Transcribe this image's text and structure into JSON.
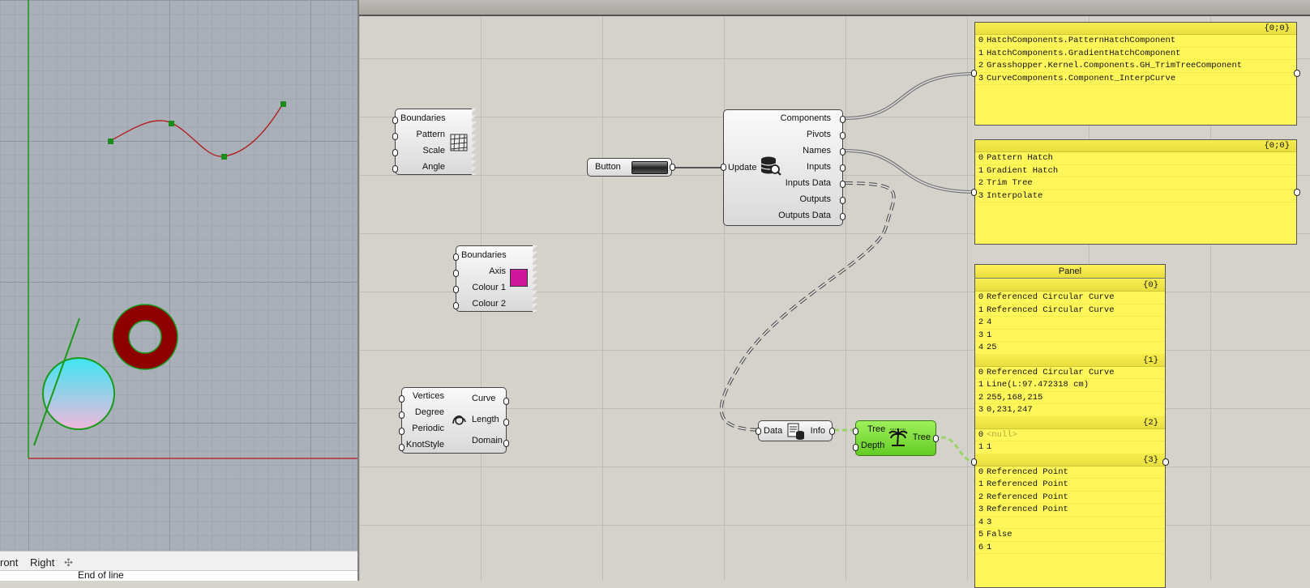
{
  "viewport": {
    "tabs": [
      "ront",
      "Right"
    ],
    "add_tab_icon": "plus-icon",
    "command_prompt": "End of line"
  },
  "components": {
    "hatch_pattern": {
      "inputs": [
        "Boundaries",
        "Pattern",
        "Scale",
        "Angle"
      ],
      "icon": "grid-hatch-icon"
    },
    "hatch_gradient": {
      "inputs": [
        "Boundaries",
        "Axis",
        "Colour 1",
        "Colour 2"
      ],
      "icon": "magenta-swatch-icon"
    },
    "interp_curve": {
      "inputs": [
        "Vertices",
        "Degree",
        "Periodic",
        "KnotStyle"
      ],
      "outputs": [
        "Curve",
        "Length",
        "Domain"
      ],
      "icon": "curve-loop-icon"
    },
    "button": {
      "label": "Button"
    },
    "component_info": {
      "input": "Update",
      "outputs": [
        "Components",
        "Pivots",
        "Names",
        "Inputs",
        "Inputs Data",
        "Outputs",
        "Outputs Data"
      ],
      "icon": "database-search-icon"
    },
    "data_info": {
      "input": "Data",
      "output": "Info",
      "icon": "data-doc-icon"
    },
    "tree": {
      "inputs": [
        "Tree",
        "Depth"
      ],
      "output": "Tree",
      "icon": "palm-tree-icon"
    }
  },
  "panels": {
    "components_panel": {
      "path": "{0;0}",
      "rows": [
        "HatchComponents.PatternHatchComponent",
        "HatchComponents.GradientHatchComponent",
        "Grasshopper.Kernel.Components.GH_TrimTreeComponent",
        "CurveComponents.Component_InterpCurve"
      ]
    },
    "names_panel": {
      "path": "{0;0}",
      "rows": [
        "Pattern Hatch",
        "Gradient Hatch",
        "Trim Tree",
        "Interpolate"
      ]
    },
    "tree_panel": {
      "title": "Panel",
      "branches": [
        {
          "path": "{0}",
          "rows": [
            "Referenced Circular Curve",
            "Referenced Circular Curve",
            "4",
            "1",
            "25"
          ]
        },
        {
          "path": "{1}",
          "rows": [
            "Referenced Circular Curve",
            "Line(L:97.472318 cm)",
            "255,168,215",
            "0,231,247"
          ]
        },
        {
          "path": "{2}",
          "rows": [
            "<null>",
            "1"
          ]
        },
        {
          "path": "{3}",
          "rows": [
            "Referenced Point",
            "Referenced Point",
            "Referenced Point",
            "Referenced Point",
            "3",
            "False",
            "1"
          ]
        }
      ]
    }
  },
  "colors": {
    "panel_yellow": "#fff75a",
    "wire": "#555555",
    "tree_green": "#7cdc3a",
    "curve_red": "#b21a1a",
    "ring_red": "#8e0000",
    "axis_green": "#1a9a1a",
    "axis_red": "#b33030"
  }
}
